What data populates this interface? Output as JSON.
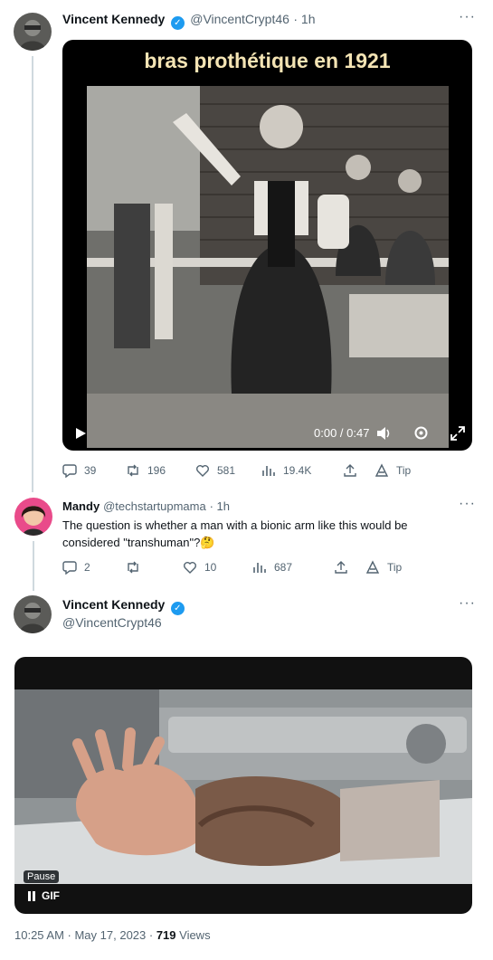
{
  "tweet1": {
    "author": "Vincent Kennedy",
    "handle": "@VincentCrypt46",
    "time": "· 1h",
    "more": "···",
    "video_caption": "bras prothétique en 1921",
    "video_time": "0:00 / 0:47",
    "stats": {
      "replies": "39",
      "retweets": "196",
      "likes": "581",
      "views": "19.4K",
      "tip": "Tip"
    }
  },
  "reply": {
    "author": "Mandy",
    "handle": "@techstartupmama",
    "time": "· 1h",
    "more": "···",
    "text": "The question is whether a man with a bionic arm like this would be considered \"transhuman\"?🤔",
    "stats": {
      "replies": "2",
      "retweets": "",
      "likes": "10",
      "views": "687",
      "tip": "Tip"
    }
  },
  "tweet2": {
    "author": "Vincent Kennedy",
    "handle": "@VincentCrypt46",
    "more": "···",
    "pause_tooltip": "Pause",
    "gif_label": "GIF",
    "date": "10:25 AM · May 17, 2023 · ",
    "views_count": "719",
    "views_label": " Views"
  }
}
